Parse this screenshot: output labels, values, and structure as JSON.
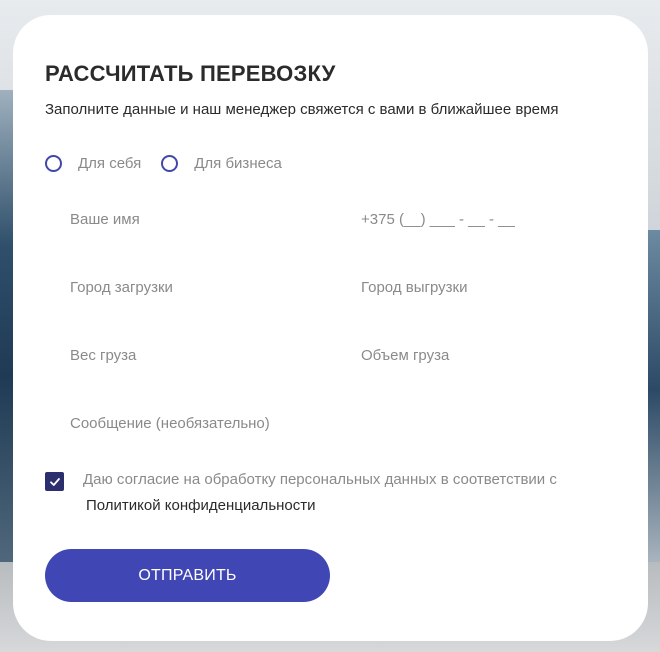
{
  "form": {
    "title": "РАССЧИТАТЬ ПЕРЕВОЗКУ",
    "subtitle": "Заполните данные и наш менеджер свяжется с вами в ближайшее время",
    "client_types": [
      {
        "label": "Для себя",
        "selected": false
      },
      {
        "label": "Для бизнеса",
        "selected": false
      }
    ],
    "fields": {
      "name": {
        "placeholder": "Ваше имя",
        "value": ""
      },
      "phone": {
        "placeholder": "+375 (__) ___ - __ - __",
        "value": ""
      },
      "city_from": {
        "placeholder": "Город загрузки",
        "value": ""
      },
      "city_to": {
        "placeholder": "Город выгрузки",
        "value": ""
      },
      "weight": {
        "placeholder": "Вес груза",
        "value": ""
      },
      "volume": {
        "placeholder": "Объем груза",
        "value": ""
      },
      "message": {
        "placeholder": "Сообщение (необязательно)",
        "value": ""
      }
    },
    "consent": {
      "checked": true,
      "text": "Даю согласие на обработку персональных данных в соответствии с",
      "link_text": "Политикой конфиденциальности"
    },
    "submit_label": "ОТПРАВИТЬ"
  },
  "colors": {
    "accent": "#4047b4",
    "checkbox": "#2c2f6e",
    "text_primary": "#2b2b2b",
    "text_muted": "#8a8a8a",
    "card_background": "#ffffff"
  },
  "icons": {
    "checkbox_checked": "check-icon"
  }
}
